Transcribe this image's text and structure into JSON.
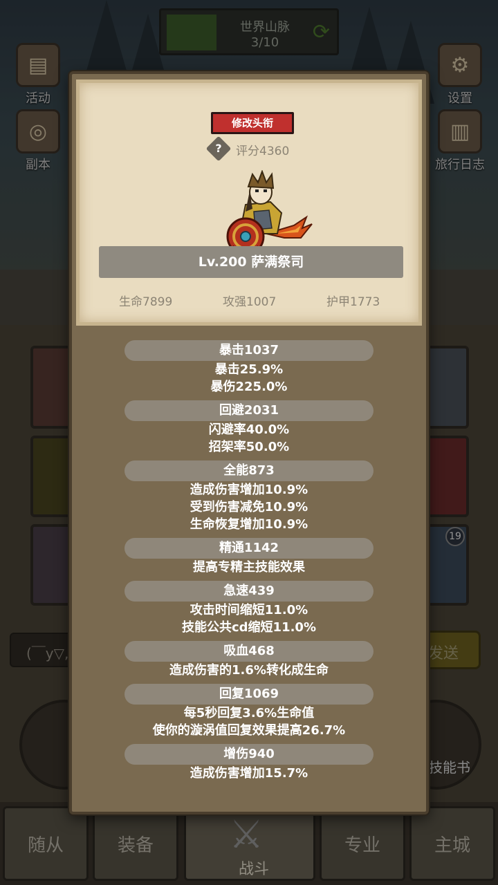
{
  "background": {
    "top_banner": {
      "title": "世界山脉",
      "progress": "3/10"
    },
    "left_buttons": [
      "活动",
      "副本"
    ],
    "right_buttons": [
      "设置",
      "旅行日志"
    ],
    "chat_placeholder": "(￣y▽,",
    "send_label": "发送",
    "skill_book_label": "技能书",
    "badge_count": "19",
    "nav": {
      "tab1": "随从",
      "tab2": "装备",
      "center": "战斗",
      "tab4": "专业",
      "tab5": "主城"
    }
  },
  "popup": {
    "rename_button": "修改头衔",
    "score": "评分4360",
    "level_name": "Lv.200 萨满祭司",
    "hp": "生命7899",
    "attack": "攻强1007",
    "armor": "护甲1773",
    "stats": [
      {
        "title": "暴击1037",
        "lines": [
          "暴击25.9%",
          "暴伤225.0%"
        ]
      },
      {
        "title": "回避2031",
        "lines": [
          "闪避率40.0%",
          "招架率50.0%"
        ]
      },
      {
        "title": "全能873",
        "lines": [
          "造成伤害增加10.9%",
          "受到伤害减免10.9%",
          "生命恢复增加10.9%"
        ]
      },
      {
        "title": "精通1142",
        "lines": [
          "提高专精主技能效果"
        ]
      },
      {
        "title": "急速439",
        "lines": [
          "攻击时间缩短11.0%",
          "技能公共cd缩短11.0%"
        ]
      },
      {
        "title": "吸血468",
        "lines": [
          "造成伤害的1.6%转化成生命"
        ]
      },
      {
        "title": "回复1069",
        "lines": [
          "每5秒回复3.6%生命值",
          "使你的漩涡值回复效果提高26.7%"
        ]
      },
      {
        "title": "增伤940",
        "lines": [
          "造成伤害增加15.7%"
        ]
      }
    ]
  }
}
